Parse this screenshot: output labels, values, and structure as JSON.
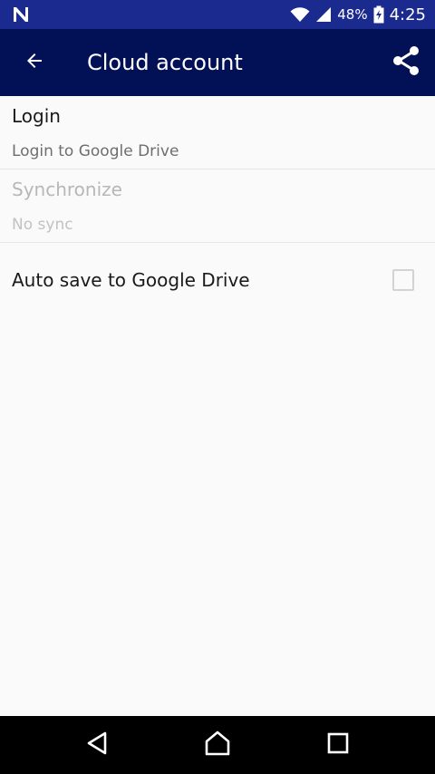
{
  "status_bar": {
    "notification_icon": "n-icon",
    "battery_percent": "48%",
    "time": "4:25"
  },
  "app_bar": {
    "title": "Cloud account",
    "back_icon": "arrow-left-icon",
    "share_icon": "share-icon"
  },
  "preferences": {
    "login": {
      "title": "Login",
      "summary": "Login to Google Drive"
    },
    "synchronize": {
      "title": "Synchronize",
      "summary": "No sync",
      "enabled": false
    },
    "auto_save": {
      "title": "Auto save to Google Drive",
      "checked": false
    }
  },
  "nav_bar": {
    "back_icon": "triangle-back-icon",
    "home_icon": "home-icon",
    "recents_icon": "square-recents-icon"
  },
  "colors": {
    "status_bar": "#1b2a8f",
    "app_bar": "#021156",
    "background": "#fafafa"
  }
}
